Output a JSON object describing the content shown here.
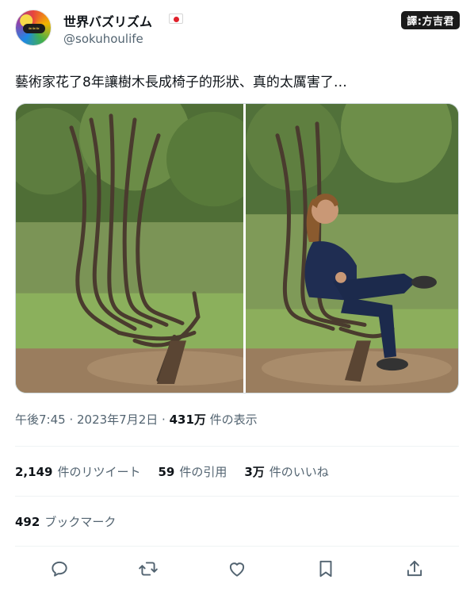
{
  "author": {
    "display_name": "世界バズリズム",
    "handle": "@sokuhoulife",
    "avatar_icon": "avatar-image"
  },
  "translator_badge": "譯:方吉君",
  "tweet": {
    "text": "藝術家花了8年讓樹木長成椅子的形狀、真的太厲害了…"
  },
  "meta": {
    "time": "午後7:45",
    "sep1": " · ",
    "date": "2023年7月2日",
    "sep2": " · ",
    "views_count": "431万",
    "views_label": " 件の表示"
  },
  "stats": {
    "retweets_count": "2,149",
    "retweets_label": "件のリツイート",
    "quotes_count": "59",
    "quotes_label": "件の引用",
    "likes_count": "3万",
    "likes_label": "件のいいね"
  },
  "bookmarks": {
    "count": "492",
    "label": "ブックマーク"
  },
  "actions": [
    "reply-icon",
    "retweet-icon",
    "like-icon",
    "bookmark-icon",
    "share-icon"
  ],
  "colors": {
    "text_primary": "#0f1419",
    "text_secondary": "#536471",
    "action_icon": "#536471",
    "flag_red": "#e0212b"
  }
}
